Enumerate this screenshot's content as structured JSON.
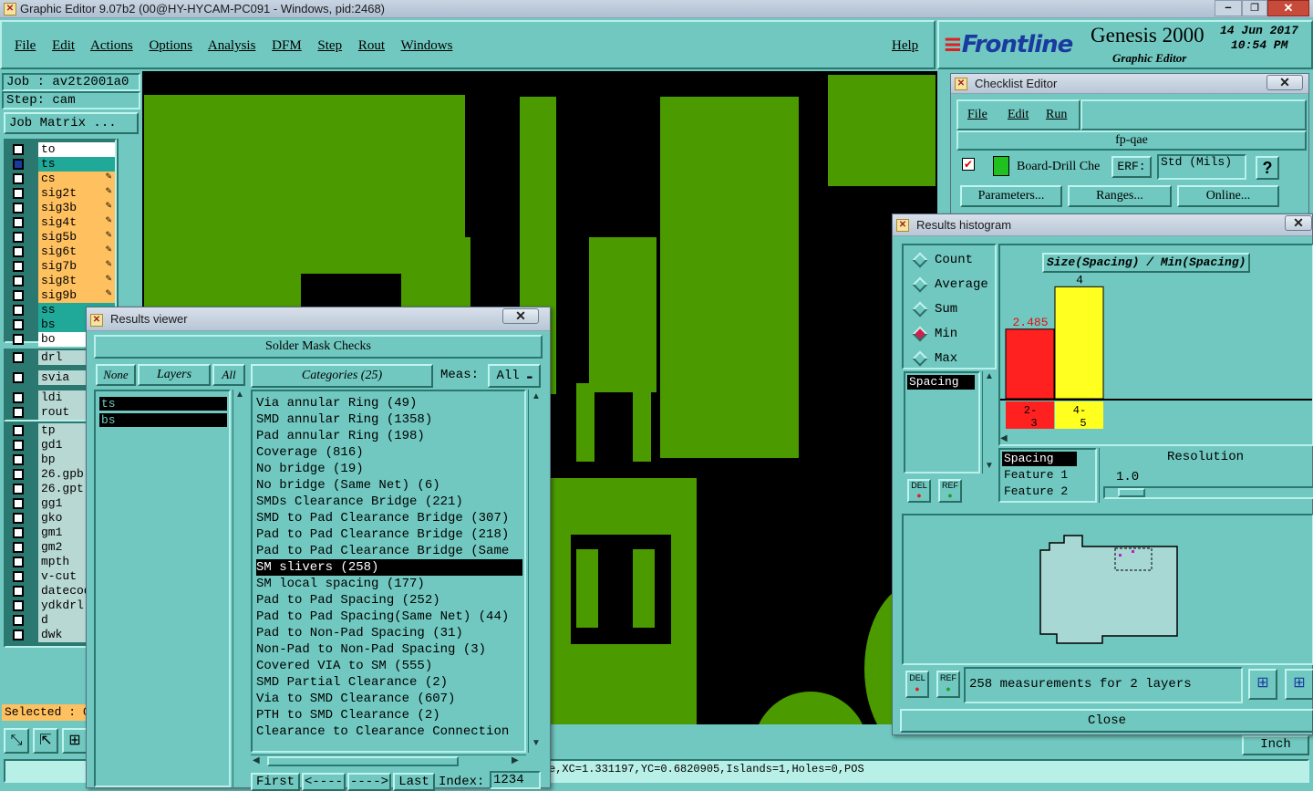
{
  "main_window": {
    "title": "Graphic Editor 9.07b2 (00@HY-HYCAM-PC091 - Windows, pid:2468)"
  },
  "menu": {
    "items": [
      "File",
      "Edit",
      "Actions",
      "Options",
      "Analysis",
      "DFM",
      "Step",
      "Rout",
      "Windows"
    ],
    "help": "Help"
  },
  "brand": {
    "logo": "Frontline",
    "product": "Genesis 2000",
    "subtitle": "Graphic Editor",
    "date": "14 Jun 2017",
    "time": "10:54 PM"
  },
  "job": {
    "job_label": "Job : av2t2001a0",
    "step_label": "Step: cam",
    "matrix_button": "Job Matrix ..."
  },
  "layers": [
    {
      "name": "to",
      "color": "#ffffff"
    },
    {
      "name": "ts",
      "color": "#20a898"
    },
    {
      "name": "cs",
      "color": "#ffc060"
    },
    {
      "name": "sig2t",
      "color": "#ffc060"
    },
    {
      "name": "sig3b",
      "color": "#ffc060"
    },
    {
      "name": "sig4t",
      "color": "#ffc060"
    },
    {
      "name": "sig5b",
      "color": "#ffc060"
    },
    {
      "name": "sig6t",
      "color": "#ffc060"
    },
    {
      "name": "sig7b",
      "color": "#ffc060"
    },
    {
      "name": "sig8t",
      "color": "#ffc060"
    },
    {
      "name": "sig9b",
      "color": "#ffc060"
    },
    {
      "name": "ss",
      "color": "#20a898"
    },
    {
      "name": "bs",
      "color": "#20a898"
    },
    {
      "name": "bo",
      "color": "#ffffff"
    }
  ],
  "layers_b": [
    {
      "name": "drl",
      "color": "#b8d8d4"
    },
    {
      "name": "svia",
      "color": "#b8d8d4"
    },
    {
      "name": "ldi",
      "color": "#b8d8d4"
    },
    {
      "name": "rout",
      "color": "#b8d8d4"
    }
  ],
  "layers_c": [
    "tp",
    "gd1",
    "bp",
    "26.gpb",
    "26.gpt",
    "gg1",
    "gko",
    "gm1",
    "gm2",
    "mpth",
    "v-cut",
    "datecode",
    "ydkdrl",
    "d",
    "dwk"
  ],
  "selected_label": "Selected : 0",
  "status_bar": "e,XC=1.331197,YC=0.6820905,Islands=1,Holes=0,POS",
  "units_button": "Inch",
  "results_viewer": {
    "title": "Results viewer",
    "header": "Solder Mask Checks",
    "none_btn": "None",
    "layers_btn": "Layers",
    "all_btn": "All",
    "categories_btn": "Categories (25)",
    "meas_label": "Meas:",
    "meas_value": "All",
    "layer_items": [
      "ts",
      "bs"
    ],
    "categories": [
      "Via annular Ring (49)",
      "SMD annular Ring (1358)",
      "Pad annular Ring (198)",
      "Coverage (816)",
      "No bridge (19)",
      "No bridge (Same Net) (6)",
      "SMDs Clearance Bridge (221)",
      "SMD to Pad Clearance Bridge (307)",
      "Pad to Pad Clearance Bridge (218)",
      "Pad to Pad Clearance Bridge (Same",
      "SM slivers (258)",
      "SM local spacing (177)",
      "Pad to Pad Spacing (252)",
      "Pad to Pad Spacing(Same Net) (44)",
      "Pad to Non-Pad Spacing (31)",
      "Non-Pad to Non-Pad Spacing (3)",
      "Covered VIA to SM (555)",
      "SMD Partial Clearance (2)",
      "Via to SMD Clearance (607)",
      "PTH to SMD Clearance (2)",
      "Clearance to Clearance Connection"
    ],
    "selected_index": 10,
    "nav": {
      "first": "First",
      "prev": "<----",
      "next": "---->",
      "last": "Last",
      "index_label": "Index:",
      "index_value": "1234"
    }
  },
  "checklist": {
    "title": "Checklist Editor",
    "menu": [
      "File",
      "Edit",
      "Run"
    ],
    "name": "fp-qae",
    "action": "Board-Drill Che",
    "erf": "ERF:",
    "std": "Std (Mils)",
    "help": "?",
    "params_btn": "Parameters...",
    "ranges_btn": "Ranges...",
    "online_btn": "Online..."
  },
  "histogram": {
    "title": "Results histogram",
    "options": [
      "Count",
      "Average",
      "Sum",
      "Min",
      "Max"
    ],
    "selected_option": "Min",
    "list_item": "Spacing",
    "chart_title": "Size(Spacing) / Min(Spacing)",
    "bars": [
      {
        "label": "2.485",
        "value": 2.485,
        "color": "#ff2020",
        "range": "2-3"
      },
      {
        "label": "4",
        "value": 4,
        "color": "#ffff20",
        "range": "4-5"
      }
    ],
    "field_list": [
      "Spacing",
      "Feature 1",
      "Feature 2"
    ],
    "resolution_label": "Resolution",
    "resolution_value": "1.0",
    "del": "DEL",
    "ref": "REF",
    "measurements": "258 measurements for 2 layers",
    "close": "Close"
  }
}
